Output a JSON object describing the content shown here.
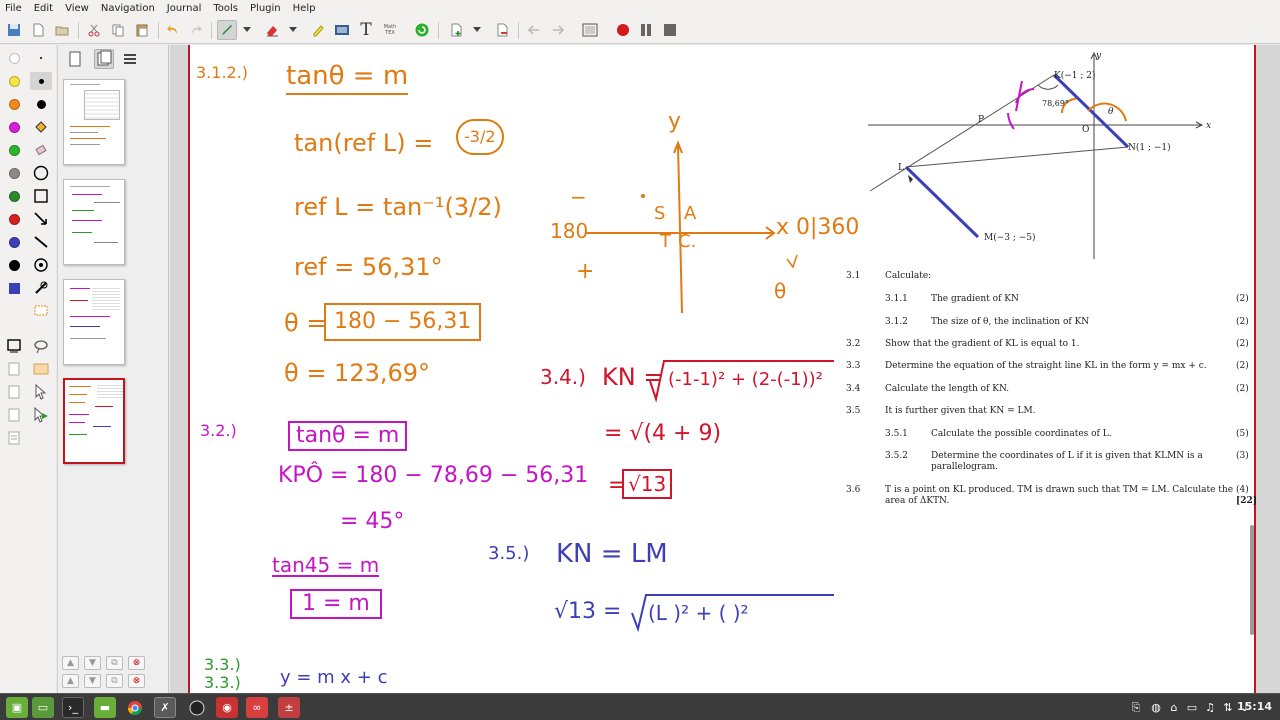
{
  "menu": [
    "File",
    "Edit",
    "View",
    "Navigation",
    "Journal",
    "Tools",
    "Plugin",
    "Help"
  ],
  "toolbar": {
    "math_tex_label": "Math TEX",
    "text_tool_label": "T"
  },
  "colors": {
    "orange": "#e07a12",
    "red": "#d0142a",
    "magenta": "#c415c4",
    "blue": "#3c3fb6",
    "green": "#2c9a2c",
    "palette": [
      "#ffffff",
      "#f5e642",
      "#f08a1c",
      "#d81ed8",
      "#2db52d",
      "#8a8a8a",
      "#2a8a2a",
      "#d42020",
      "#3c3fb6",
      "#000000"
    ]
  },
  "notes": {
    "q312_label": "3.1.2.)",
    "tan_eq_m": "tanθ = m",
    "tan_ref": "tan(ref L) = ",
    "tan_ref_value": "-3/2",
    "ref_inverse": "ref L = tan⁻¹(3/2)",
    "ref_value": "ref = 56,31°",
    "theta_eq": "θ = ",
    "theta_expr": "180 − 56,31",
    "theta_result": "θ = 123,69°",
    "q32_label": "3.2.)",
    "q32_tan": "tanθ = m",
    "kpo": "KPÔ = 180 − 78,69 − 56,31",
    "kpo_result": "= 45°",
    "tan45": "tan45 = m",
    "one_eq_m": "1 = m",
    "q33_label": "3.3.)",
    "q33_label_dup": "3.3.)",
    "q33_partial": "y = m x + c",
    "axis_y": "y",
    "quad_s": "S",
    "quad_a": "A",
    "quad_t": "T",
    "quad_c": "C.",
    "axis_180": "180",
    "axis_x_label": "x 0|360",
    "minus_mark": "−",
    "plus_mark": "+",
    "theta_mark": "θ",
    "q34_label": "3.4.)",
    "q34_kn": "KN = ",
    "q34_expr": "(-1-1)² + (2-(-1))²",
    "q34_step2": "= √(4 + 9)",
    "q34_eq": "=",
    "q34_result": "√13",
    "q35_label": "3.5.)",
    "q35_kn_lm": "KN = LM",
    "q35_sqrt13": "√13 = ",
    "q35_expr": "(L          )² + (         )²"
  },
  "diagram": {
    "K": "K(−1 ; 2)",
    "N": "N(1 ; −1)",
    "L": "L",
    "M": "M(−3 ; −5)",
    "P": "P",
    "O": "O",
    "angle": "78,69°",
    "theta": "θ",
    "x_axis": "x",
    "y_axis": "y"
  },
  "questions": [
    {
      "num": "3.1",
      "text": "Calculate:",
      "marks": ""
    },
    {
      "num": "3.1.1",
      "text": "The gradient of  KN",
      "marks": "(2)"
    },
    {
      "num": "3.1.2",
      "text": "The size of  θ,  the inclination of  KN",
      "marks": "(2)"
    },
    {
      "num": "3.2",
      "text": "Show that the gradient of  KL  is equal to 1.",
      "marks": "(2)"
    },
    {
      "num": "3.3",
      "text": "Determine the equation of the straight line  KL  in the form  y = mx + c.",
      "marks": "(2)"
    },
    {
      "num": "3.4",
      "text": "Calculate the length of  KN.",
      "marks": "(2)"
    },
    {
      "num": "3.5",
      "text": "It is further given that  KN = LM.",
      "marks": ""
    },
    {
      "num": "3.5.1",
      "text": "Calculate the possible coordinates of  L.",
      "marks": "(5)"
    },
    {
      "num": "3.5.2",
      "text": "Determine the coordinates of  L  if it is given that  KLMN  is a",
      "marks": "(3)"
    },
    {
      "num": "",
      "text": "parallelogram.",
      "marks": ""
    },
    {
      "num": "3.6",
      "text": "T  is a point on  KL  produced.  TM  is drawn such that  TM = LM.  Calculate the",
      "marks": "(4)"
    },
    {
      "num": "",
      "text": "area of  ΔKTN.",
      "marks": "[22]"
    }
  ],
  "taskbar": {
    "clock": "15:14"
  }
}
